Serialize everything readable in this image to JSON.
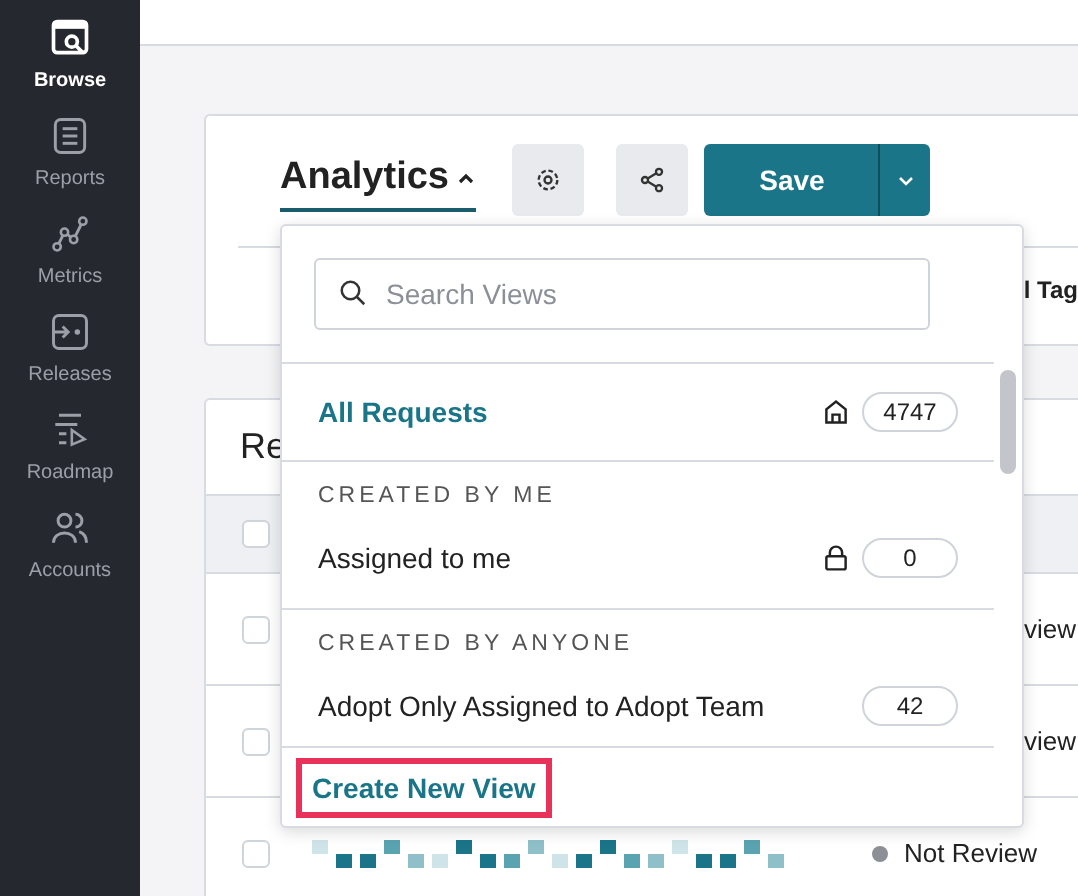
{
  "sidebar": {
    "items": [
      {
        "label": "Browse",
        "selected": true
      },
      {
        "label": "Reports",
        "selected": false
      },
      {
        "label": "Metrics",
        "selected": false
      },
      {
        "label": "Releases",
        "selected": false
      },
      {
        "label": "Roadmap",
        "selected": false
      },
      {
        "label": "Accounts",
        "selected": false
      }
    ]
  },
  "toolbar": {
    "view_title": "Analytics",
    "save_label": "Save",
    "tab_fragment": "l Tag"
  },
  "table": {
    "title_fragment": "Re",
    "header_checked": false,
    "rows": [
      {
        "status": "view",
        "redacted": false,
        "checked": false
      },
      {
        "status": "view",
        "redacted": false,
        "checked": false
      },
      {
        "status": "Not Review",
        "redacted": true,
        "checked": false
      }
    ]
  },
  "views_menu": {
    "search": {
      "placeholder": "Search Views"
    },
    "default_view": {
      "label": "All Requests",
      "count": "4747"
    },
    "sections": [
      {
        "heading": "CREATED BY ME",
        "items": [
          {
            "label": "Assigned to me",
            "count": "0",
            "locked": true
          }
        ]
      },
      {
        "heading": "CREATED BY ANYONE",
        "items": [
          {
            "label": "Adopt Only Assigned to Adopt Team",
            "count": "42",
            "locked": false
          }
        ]
      }
    ],
    "create_label": "Create New View",
    "create_highlighted": true
  }
}
